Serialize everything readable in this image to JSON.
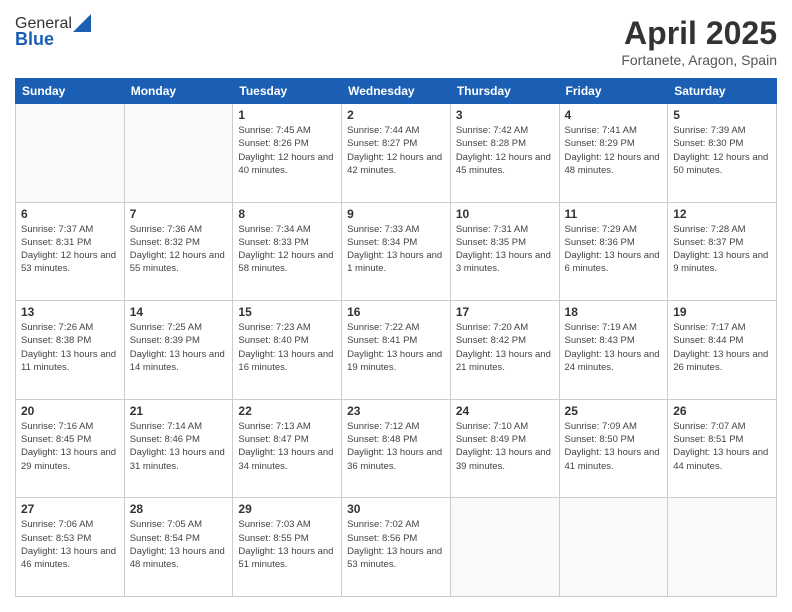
{
  "logo": {
    "general": "General",
    "blue": "Blue"
  },
  "title": "April 2025",
  "location": "Fortanete, Aragon, Spain",
  "days_header": [
    "Sunday",
    "Monday",
    "Tuesday",
    "Wednesday",
    "Thursday",
    "Friday",
    "Saturday"
  ],
  "weeks": [
    [
      {
        "day": "",
        "info": ""
      },
      {
        "day": "",
        "info": ""
      },
      {
        "day": "1",
        "info": "Sunrise: 7:45 AM\nSunset: 8:26 PM\nDaylight: 12 hours and 40 minutes."
      },
      {
        "day": "2",
        "info": "Sunrise: 7:44 AM\nSunset: 8:27 PM\nDaylight: 12 hours and 42 minutes."
      },
      {
        "day": "3",
        "info": "Sunrise: 7:42 AM\nSunset: 8:28 PM\nDaylight: 12 hours and 45 minutes."
      },
      {
        "day": "4",
        "info": "Sunrise: 7:41 AM\nSunset: 8:29 PM\nDaylight: 12 hours and 48 minutes."
      },
      {
        "day": "5",
        "info": "Sunrise: 7:39 AM\nSunset: 8:30 PM\nDaylight: 12 hours and 50 minutes."
      }
    ],
    [
      {
        "day": "6",
        "info": "Sunrise: 7:37 AM\nSunset: 8:31 PM\nDaylight: 12 hours and 53 minutes."
      },
      {
        "day": "7",
        "info": "Sunrise: 7:36 AM\nSunset: 8:32 PM\nDaylight: 12 hours and 55 minutes."
      },
      {
        "day": "8",
        "info": "Sunrise: 7:34 AM\nSunset: 8:33 PM\nDaylight: 12 hours and 58 minutes."
      },
      {
        "day": "9",
        "info": "Sunrise: 7:33 AM\nSunset: 8:34 PM\nDaylight: 13 hours and 1 minute."
      },
      {
        "day": "10",
        "info": "Sunrise: 7:31 AM\nSunset: 8:35 PM\nDaylight: 13 hours and 3 minutes."
      },
      {
        "day": "11",
        "info": "Sunrise: 7:29 AM\nSunset: 8:36 PM\nDaylight: 13 hours and 6 minutes."
      },
      {
        "day": "12",
        "info": "Sunrise: 7:28 AM\nSunset: 8:37 PM\nDaylight: 13 hours and 9 minutes."
      }
    ],
    [
      {
        "day": "13",
        "info": "Sunrise: 7:26 AM\nSunset: 8:38 PM\nDaylight: 13 hours and 11 minutes."
      },
      {
        "day": "14",
        "info": "Sunrise: 7:25 AM\nSunset: 8:39 PM\nDaylight: 13 hours and 14 minutes."
      },
      {
        "day": "15",
        "info": "Sunrise: 7:23 AM\nSunset: 8:40 PM\nDaylight: 13 hours and 16 minutes."
      },
      {
        "day": "16",
        "info": "Sunrise: 7:22 AM\nSunset: 8:41 PM\nDaylight: 13 hours and 19 minutes."
      },
      {
        "day": "17",
        "info": "Sunrise: 7:20 AM\nSunset: 8:42 PM\nDaylight: 13 hours and 21 minutes."
      },
      {
        "day": "18",
        "info": "Sunrise: 7:19 AM\nSunset: 8:43 PM\nDaylight: 13 hours and 24 minutes."
      },
      {
        "day": "19",
        "info": "Sunrise: 7:17 AM\nSunset: 8:44 PM\nDaylight: 13 hours and 26 minutes."
      }
    ],
    [
      {
        "day": "20",
        "info": "Sunrise: 7:16 AM\nSunset: 8:45 PM\nDaylight: 13 hours and 29 minutes."
      },
      {
        "day": "21",
        "info": "Sunrise: 7:14 AM\nSunset: 8:46 PM\nDaylight: 13 hours and 31 minutes."
      },
      {
        "day": "22",
        "info": "Sunrise: 7:13 AM\nSunset: 8:47 PM\nDaylight: 13 hours and 34 minutes."
      },
      {
        "day": "23",
        "info": "Sunrise: 7:12 AM\nSunset: 8:48 PM\nDaylight: 13 hours and 36 minutes."
      },
      {
        "day": "24",
        "info": "Sunrise: 7:10 AM\nSunset: 8:49 PM\nDaylight: 13 hours and 39 minutes."
      },
      {
        "day": "25",
        "info": "Sunrise: 7:09 AM\nSunset: 8:50 PM\nDaylight: 13 hours and 41 minutes."
      },
      {
        "day": "26",
        "info": "Sunrise: 7:07 AM\nSunset: 8:51 PM\nDaylight: 13 hours and 44 minutes."
      }
    ],
    [
      {
        "day": "27",
        "info": "Sunrise: 7:06 AM\nSunset: 8:53 PM\nDaylight: 13 hours and 46 minutes."
      },
      {
        "day": "28",
        "info": "Sunrise: 7:05 AM\nSunset: 8:54 PM\nDaylight: 13 hours and 48 minutes."
      },
      {
        "day": "29",
        "info": "Sunrise: 7:03 AM\nSunset: 8:55 PM\nDaylight: 13 hours and 51 minutes."
      },
      {
        "day": "30",
        "info": "Sunrise: 7:02 AM\nSunset: 8:56 PM\nDaylight: 13 hours and 53 minutes."
      },
      {
        "day": "",
        "info": ""
      },
      {
        "day": "",
        "info": ""
      },
      {
        "day": "",
        "info": ""
      }
    ]
  ]
}
